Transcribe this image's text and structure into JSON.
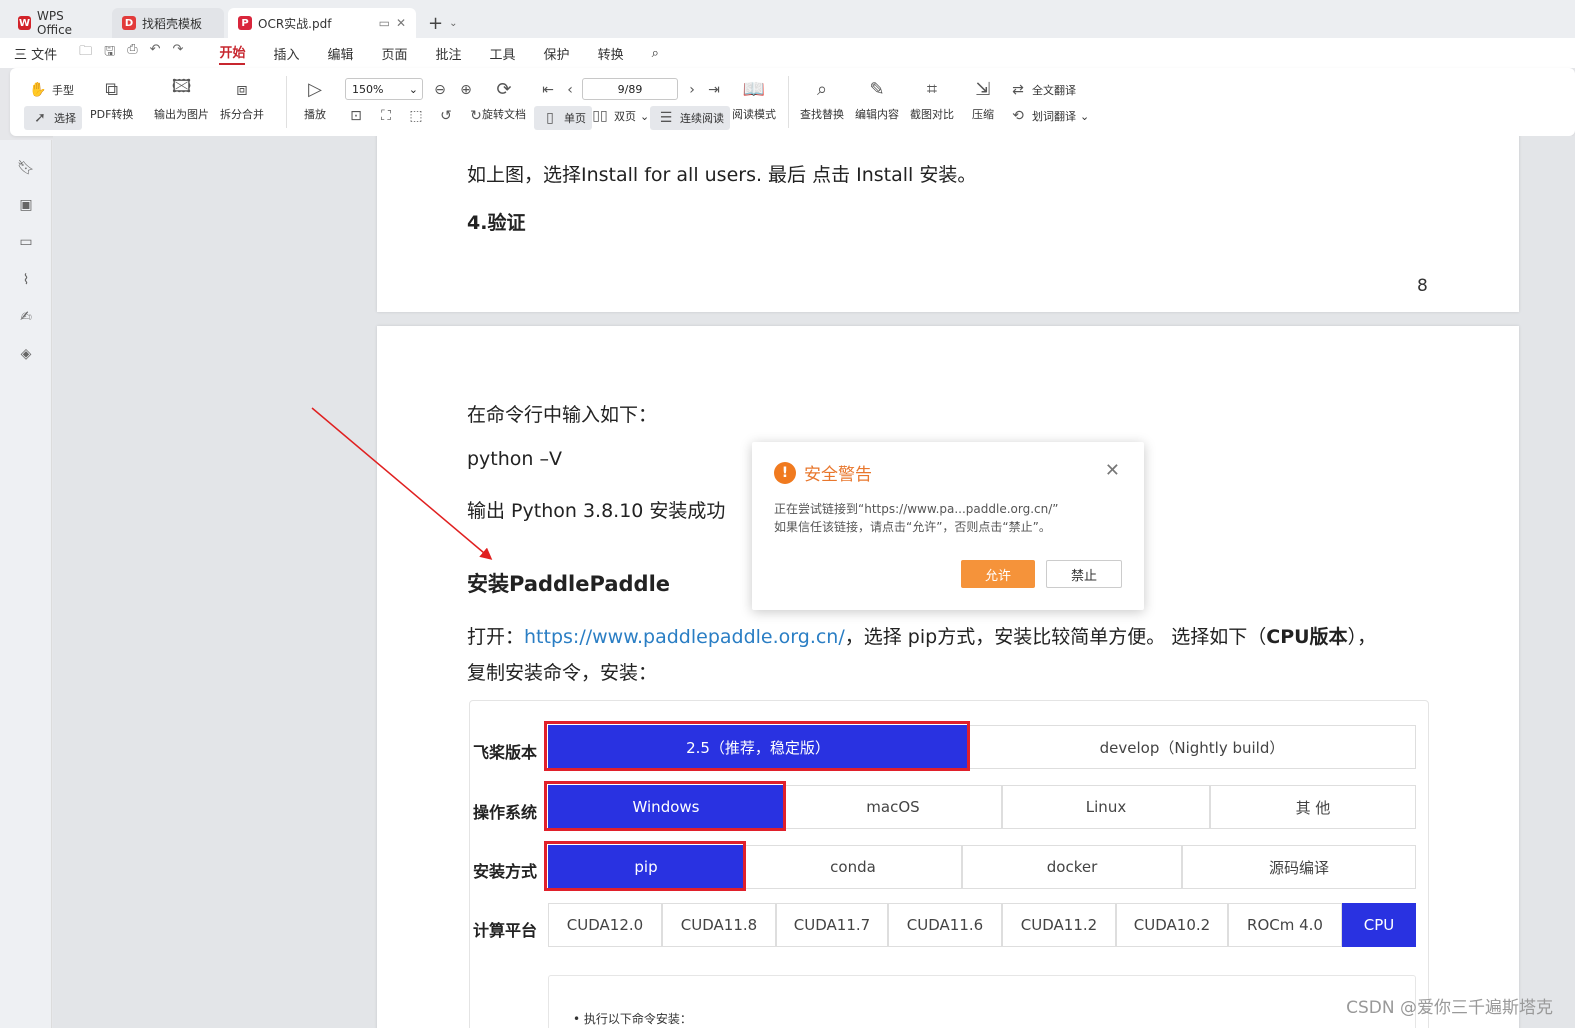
{
  "tabs": [
    {
      "label": "WPS Office",
      "logo": "W",
      "color": "#d2232a"
    },
    {
      "label": "找稻壳模板",
      "logo": "D",
      "color": "#e23b3b"
    },
    {
      "label": "OCR实战.pdf",
      "logo": "P",
      "color": "#d9263c"
    }
  ],
  "menu": {
    "file": "三 文件",
    "items": [
      "开始",
      "插入",
      "编辑",
      "页面",
      "批注",
      "工具",
      "保护",
      "转换"
    ],
    "active": "开始"
  },
  "ribbon": {
    "hand": "手型",
    "select": "选择",
    "pdf_convert": "PDF转换",
    "export_image": "输出为图片",
    "split_merge": "拆分合并",
    "play": "播放",
    "zoom": "150%",
    "page": "9/89",
    "rotate": "旋转文档",
    "single": "单页",
    "double": "双页",
    "continuous": "连续阅读",
    "read_mode": "阅读模式",
    "find_replace": "查找替换",
    "edit_content": "编辑内容",
    "screenshot_compare": "截图对比",
    "compress": "压缩",
    "full_translate": "全文翻译",
    "word_translate": "划词翻译"
  },
  "page1": {
    "line1": "如上图，选择Install for all users. 最后 点击 Install 安装。",
    "heading": "4.验证",
    "page_number": "8"
  },
  "page2": {
    "line1": "在命令行中输入如下：",
    "line2": "python –V",
    "line3": "输出 Python 3.8.10 安装成功",
    "heading": "安装PaddlePaddle",
    "open_prefix": "打开：",
    "link": "https://www.paddlepaddle.org.cn/",
    "open_suffix": "，选择 pip方式，安装比较简单方便。 选择如下（",
    "open_bold": "CPU版本",
    "open_end": "），",
    "line5": "复制安装命令，安装：",
    "cmd_hint": "• 执行以下命令安装："
  },
  "paddle_table": {
    "rows": [
      {
        "label": "飞桨版本",
        "options": [
          "2.5（推荐，稳定版）",
          "develop（Nightly build）"
        ],
        "selected": 0
      },
      {
        "label": "操作系统",
        "options": [
          "Windows",
          "macOS",
          "Linux",
          "其 他"
        ],
        "selected": 0
      },
      {
        "label": "安装方式",
        "options": [
          "pip",
          "conda",
          "docker",
          "源码编译"
        ],
        "selected": 0
      },
      {
        "label": "计算平台",
        "options": [
          "CUDA12.0",
          "CUDA11.8",
          "CUDA11.7",
          "CUDA11.6",
          "CUDA11.2",
          "CUDA10.2",
          "ROCm 4.0",
          "CPU"
        ],
        "selected": 7
      }
    ]
  },
  "dialog": {
    "title": "安全警告",
    "msg1": "正在尝试链接到“https://www.pa...paddle.org.cn/”",
    "msg2": "如果信任该链接，请点击“允许”，否则点击“禁止”。",
    "allow": "允许",
    "deny": "禁止"
  },
  "watermark": "CSDN @爱你三千遍斯塔克"
}
